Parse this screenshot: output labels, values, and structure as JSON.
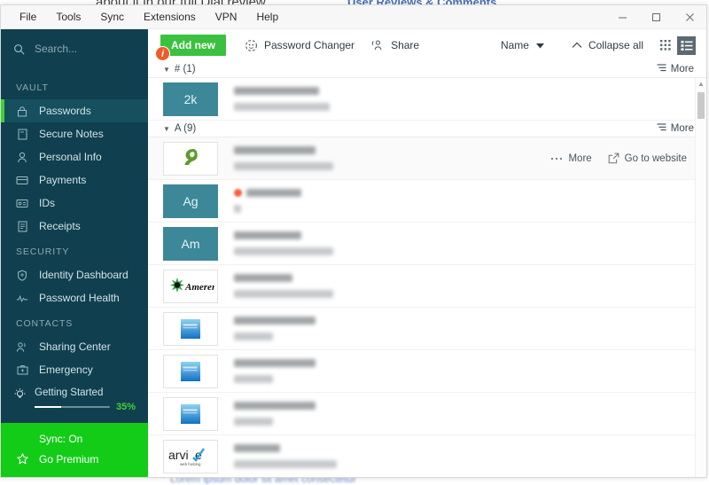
{
  "background": {
    "text_top": "about it in our full Dial review.",
    "text_top_link": "User Reviews & Comments",
    "text_bottom": "Lorem ipsum dolor sit amet consectetur"
  },
  "window": {
    "menu": [
      {
        "label": "File"
      },
      {
        "label": "Tools"
      },
      {
        "label": "Sync"
      },
      {
        "label": "Extensions"
      },
      {
        "label": "VPN"
      },
      {
        "label": "Help"
      }
    ],
    "controls": {
      "minimize": "minimize",
      "maximize": "maximize",
      "close": "close"
    }
  },
  "sidebar": {
    "search": {
      "placeholder": "Search...",
      "value": ""
    },
    "sections": [
      {
        "label": "VAULT",
        "items": [
          {
            "label": "Passwords",
            "icon": "lock-icon",
            "active": true
          },
          {
            "label": "Secure Notes",
            "icon": "note-icon",
            "active": false
          },
          {
            "label": "Personal Info",
            "icon": "person-icon",
            "active": false
          },
          {
            "label": "Payments",
            "icon": "card-icon",
            "active": false
          },
          {
            "label": "IDs",
            "icon": "id-icon",
            "active": false
          },
          {
            "label": "Receipts",
            "icon": "receipt-icon",
            "active": false
          }
        ]
      },
      {
        "label": "SECURITY",
        "items": [
          {
            "label": "Identity Dashboard",
            "icon": "shield-icon",
            "active": false
          },
          {
            "label": "Password Health",
            "icon": "pulse-icon",
            "active": false
          }
        ]
      },
      {
        "label": "CONTACTS",
        "items": [
          {
            "label": "Sharing Center",
            "icon": "people-icon",
            "active": false
          },
          {
            "label": "Emergency",
            "icon": "briefcase-icon",
            "active": false
          }
        ]
      }
    ],
    "getting_started": {
      "label": "Getting Started",
      "percent_label": "35%",
      "percent": 35,
      "icon": "lightbulb-icon"
    },
    "footer": [
      {
        "label": "Sync: On",
        "icon": ""
      },
      {
        "label": "Go Premium",
        "icon": "star-icon"
      }
    ],
    "colors": {
      "background": "#10404f",
      "active": "#16505f",
      "accent": "#3fd235",
      "footer": "#13cc17"
    }
  },
  "toolbar": {
    "add_new_label": "Add new",
    "info_badge": "i",
    "password_changer_label": "Password Changer",
    "share_label": "Share",
    "sort_label": "Name",
    "collapse_all_label": "Collapse all",
    "view_grid": "grid-view-icon",
    "view_list": "list-view-icon",
    "view_active": "list"
  },
  "list": {
    "more_label": "More",
    "go_to_website_label": "Go to website",
    "groups": [
      {
        "title": "# (1)",
        "more_label": "More",
        "rows": [
          {
            "thumb_type": "letters",
            "thumb_text": "2k",
            "line1_width": 96,
            "line2_width": 108,
            "hovered": false,
            "dot": false
          }
        ]
      },
      {
        "title": "A (9)",
        "more_label": "More",
        "rows": [
          {
            "thumb_type": "logo-a2",
            "thumb_text": "",
            "line1_width": 92,
            "line2_width": 112,
            "hovered": true,
            "dot": false
          },
          {
            "thumb_type": "letters",
            "thumb_text": "Ag",
            "line1_width": 62,
            "line2_width": 8,
            "hovered": false,
            "dot": true
          },
          {
            "thumb_type": "letters",
            "thumb_text": "Am",
            "line1_width": 76,
            "line2_width": 112,
            "hovered": false,
            "dot": false
          },
          {
            "thumb_type": "logo-ameren",
            "thumb_text": "Ameren",
            "line1_width": 66,
            "line2_width": 112,
            "hovered": false,
            "dot": false
          },
          {
            "thumb_type": "logo-amex",
            "thumb_text": "",
            "line1_width": 92,
            "line2_width": 44,
            "hovered": false,
            "dot": false
          },
          {
            "thumb_type": "logo-amex",
            "thumb_text": "",
            "line1_width": 92,
            "line2_width": 44,
            "hovered": false,
            "dot": false
          },
          {
            "thumb_type": "logo-amex",
            "thumb_text": "",
            "line1_width": 92,
            "line2_width": 44,
            "hovered": false,
            "dot": false
          },
          {
            "thumb_type": "logo-arvixe",
            "thumb_text": "arvixe",
            "line1_width": 52,
            "line2_width": 116,
            "hovered": false,
            "dot": false
          }
        ]
      }
    ]
  }
}
